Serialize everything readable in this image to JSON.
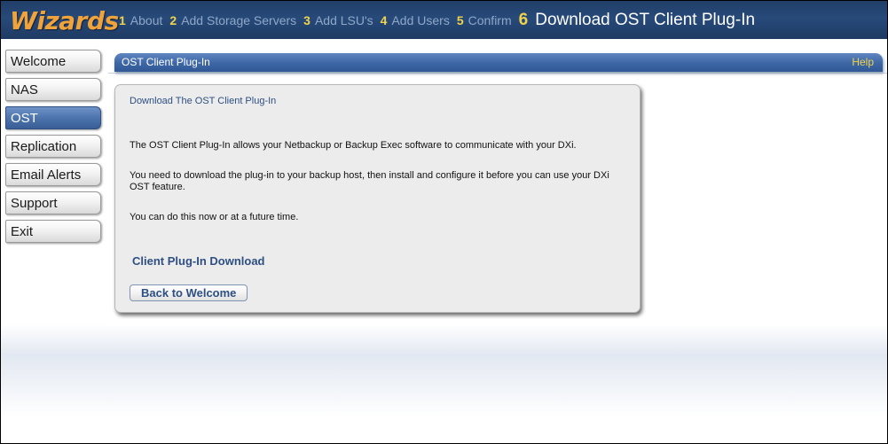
{
  "app": {
    "logo_text": "Wizards"
  },
  "steps": [
    {
      "number": "1",
      "label": "About"
    },
    {
      "number": "2",
      "label": "Add Storage Servers"
    },
    {
      "number": "3",
      "label": "Add LSU's"
    },
    {
      "number": "4",
      "label": "Add Users"
    },
    {
      "number": "5",
      "label": "Confirm"
    },
    {
      "number": "6",
      "label": "Download OST Client Plug-In",
      "current": true
    }
  ],
  "sidebar": {
    "items": [
      {
        "label": "Welcome"
      },
      {
        "label": "NAS"
      },
      {
        "label": "OST",
        "active": true
      },
      {
        "label": "Replication"
      },
      {
        "label": "Email Alerts"
      },
      {
        "label": "Support"
      },
      {
        "label": "Exit"
      }
    ]
  },
  "panel": {
    "title": "OST Client Plug-In",
    "help_label": "Help"
  },
  "card": {
    "heading": "Download The OST Client Plug-In",
    "paragraph_1": "The OST Client Plug-In allows your Netbackup or Backup Exec software to communicate with your DXi.",
    "paragraph_2": "You need to download the plug-in to your backup host, then install and configure it before you can use your DXi OST feature.",
    "paragraph_3": "You can do this now or at a future time.",
    "download_link": "Client Plug-In Download",
    "back_button": "Back to Welcome"
  },
  "colors": {
    "header_blue": "#274a7a",
    "logo_orange": "#f0a33a",
    "step_number_yellow": "#f0d34a",
    "active_nav_blue": "#4d74ad",
    "link_blue": "#2d4f82"
  }
}
